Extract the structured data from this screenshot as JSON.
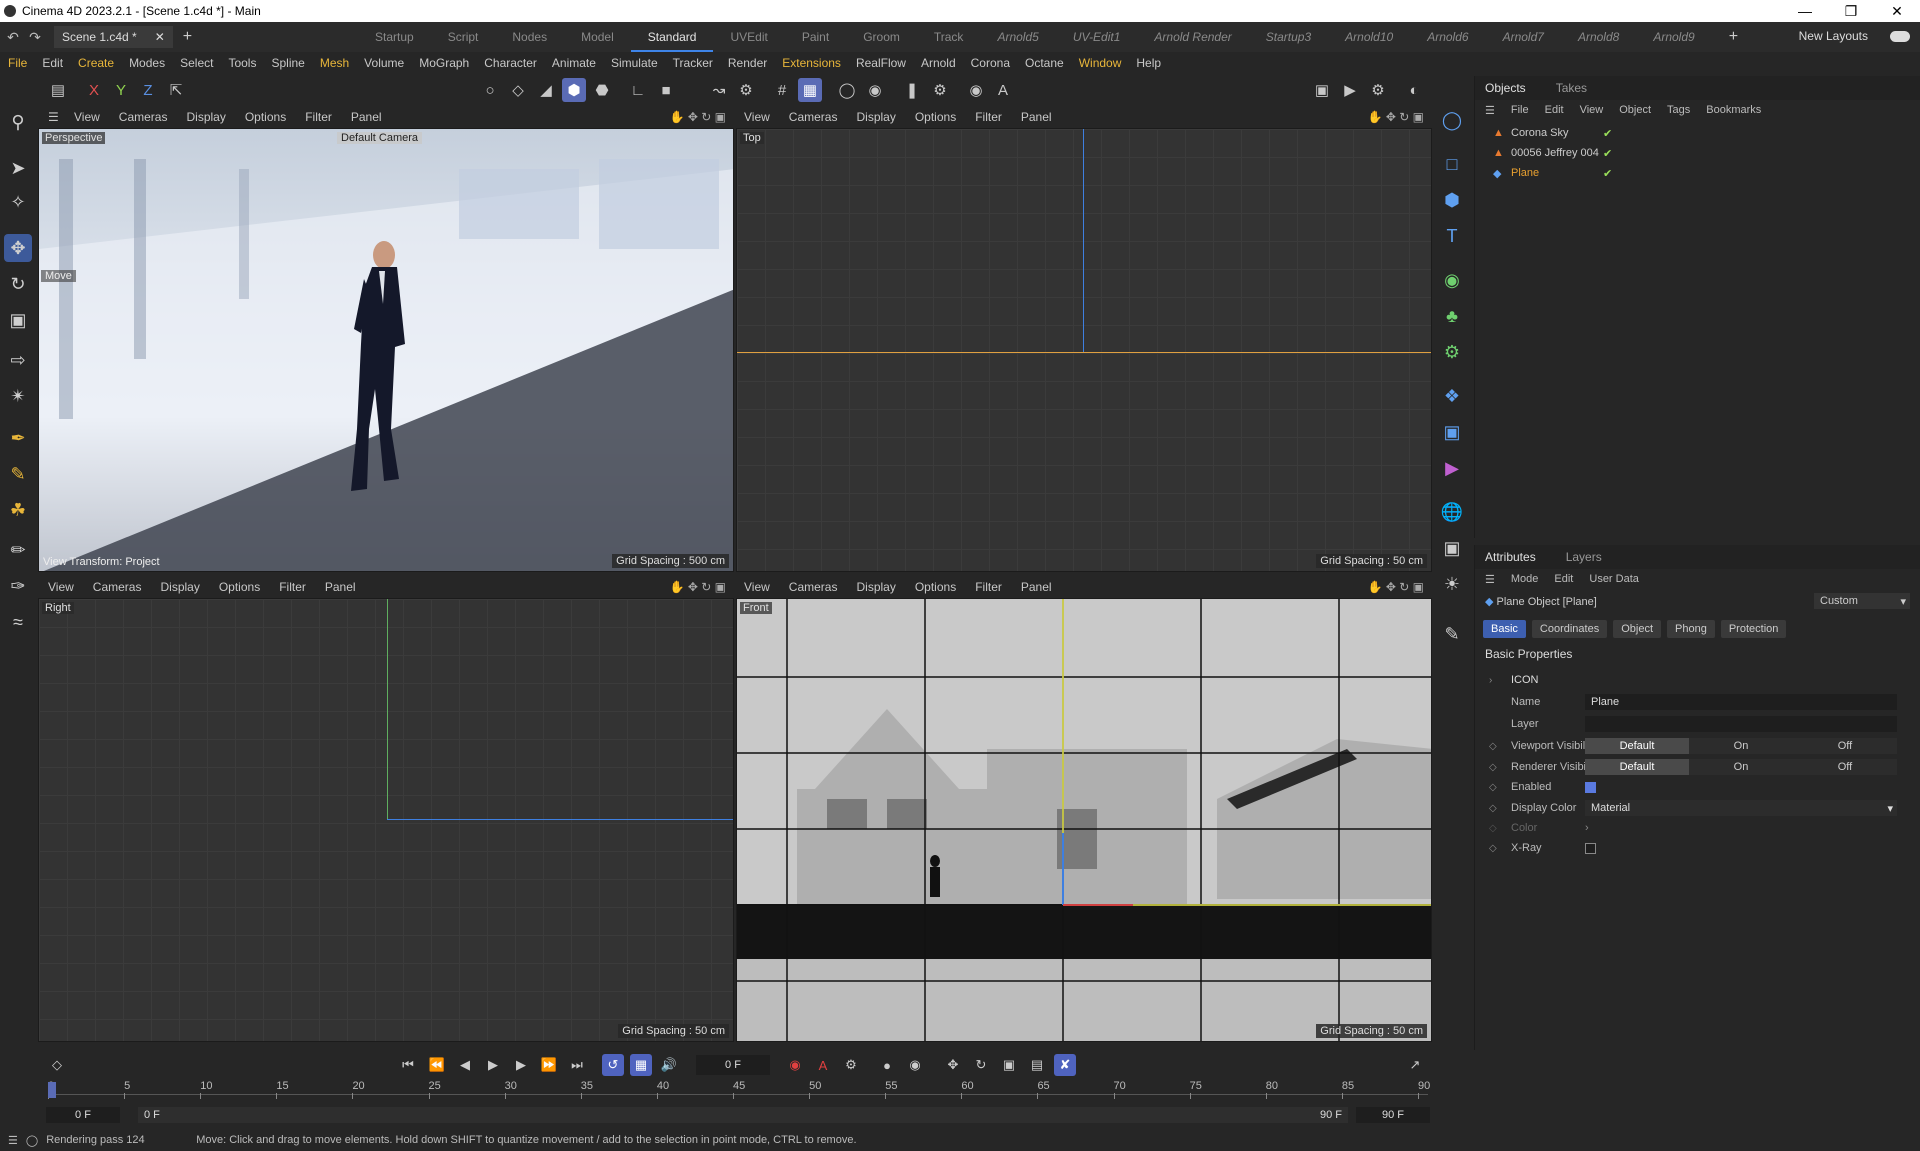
{
  "window": {
    "title": "Cinema 4D 2023.2.1 - [Scene 1.c4d *] - Main"
  },
  "scene_tab": "Scene 1.c4d *",
  "layout_tabs": [
    "Startup",
    "Script",
    "Nodes",
    "Model",
    "Standard",
    "UVEdit",
    "Paint",
    "Groom",
    "Track",
    "Arnold5",
    "UV-Edit1",
    "Arnold Render",
    "Startup3",
    "Arnold10",
    "Arnold6",
    "Arnold7",
    "Arnold8",
    "Arnold9"
  ],
  "new_layouts": "New Layouts",
  "menu": [
    "File",
    "Edit",
    "Create",
    "Modes",
    "Select",
    "Tools",
    "Spline",
    "Mesh",
    "Volume",
    "MoGraph",
    "Character",
    "Animate",
    "Simulate",
    "Tracker",
    "Render",
    "Extensions",
    "RealFlow",
    "Arnold",
    "Corona",
    "Octane",
    "Window",
    "Help"
  ],
  "viewport_menu": [
    "View",
    "Cameras",
    "Display",
    "Options",
    "Filter",
    "Panel"
  ],
  "viewports": {
    "perspective": {
      "label": "Perspective",
      "camera": "Default Camera",
      "view_transform": "View Transform: Project",
      "grid": "Grid Spacing : 500 cm",
      "tool_label": "Move"
    },
    "top": {
      "label": "Top",
      "grid": "Grid Spacing : 50 cm"
    },
    "right": {
      "label": "Right",
      "grid": "Grid Spacing : 50 cm"
    },
    "front": {
      "label": "Front",
      "grid": "Grid Spacing : 50 cm"
    }
  },
  "objects_panel": {
    "tabs": [
      "Objects",
      "Takes"
    ],
    "menu": [
      "File",
      "Edit",
      "View",
      "Object",
      "Tags",
      "Bookmarks"
    ],
    "items": [
      {
        "name": "Corona Sky"
      },
      {
        "name": "00056 Jeffrey 004"
      },
      {
        "name": "Plane"
      }
    ]
  },
  "attributes_panel": {
    "tabs": [
      "Attributes",
      "Layers"
    ],
    "menu": [
      "Mode",
      "Edit",
      "User Data"
    ],
    "object_title": "Plane Object [Plane]",
    "preset": "Custom",
    "sub_tabs": [
      "Basic",
      "Coordinates",
      "Object",
      "Phong",
      "Protection"
    ],
    "section": "Basic Properties",
    "group": "ICON",
    "name_label": "Name",
    "name_value": "Plane",
    "layer_label": "Layer",
    "viewport_visibility": "Viewport Visibility",
    "renderer_visibility": "Renderer Visibility",
    "vis_options": [
      "Default",
      "On",
      "Off"
    ],
    "enabled_label": "Enabled",
    "display_color_label": "Display Color",
    "display_color_value": "Material",
    "color_label": "Color",
    "xray_label": "X-Ray"
  },
  "timeline": {
    "current_frame": "0 F",
    "ticks": [
      "0",
      "5",
      "10",
      "15",
      "20",
      "25",
      "30",
      "35",
      "40",
      "45",
      "50",
      "55",
      "60",
      "65",
      "70",
      "75",
      "80",
      "85",
      "90"
    ],
    "start": "0 F",
    "start2": "0 F",
    "end": "90 F",
    "end2": "90 F"
  },
  "status": {
    "render": "Rendering pass 124",
    "hint": "Move: Click and drag to move elements. Hold down SHIFT to quantize movement / add to the selection in point mode, CTRL to remove."
  }
}
